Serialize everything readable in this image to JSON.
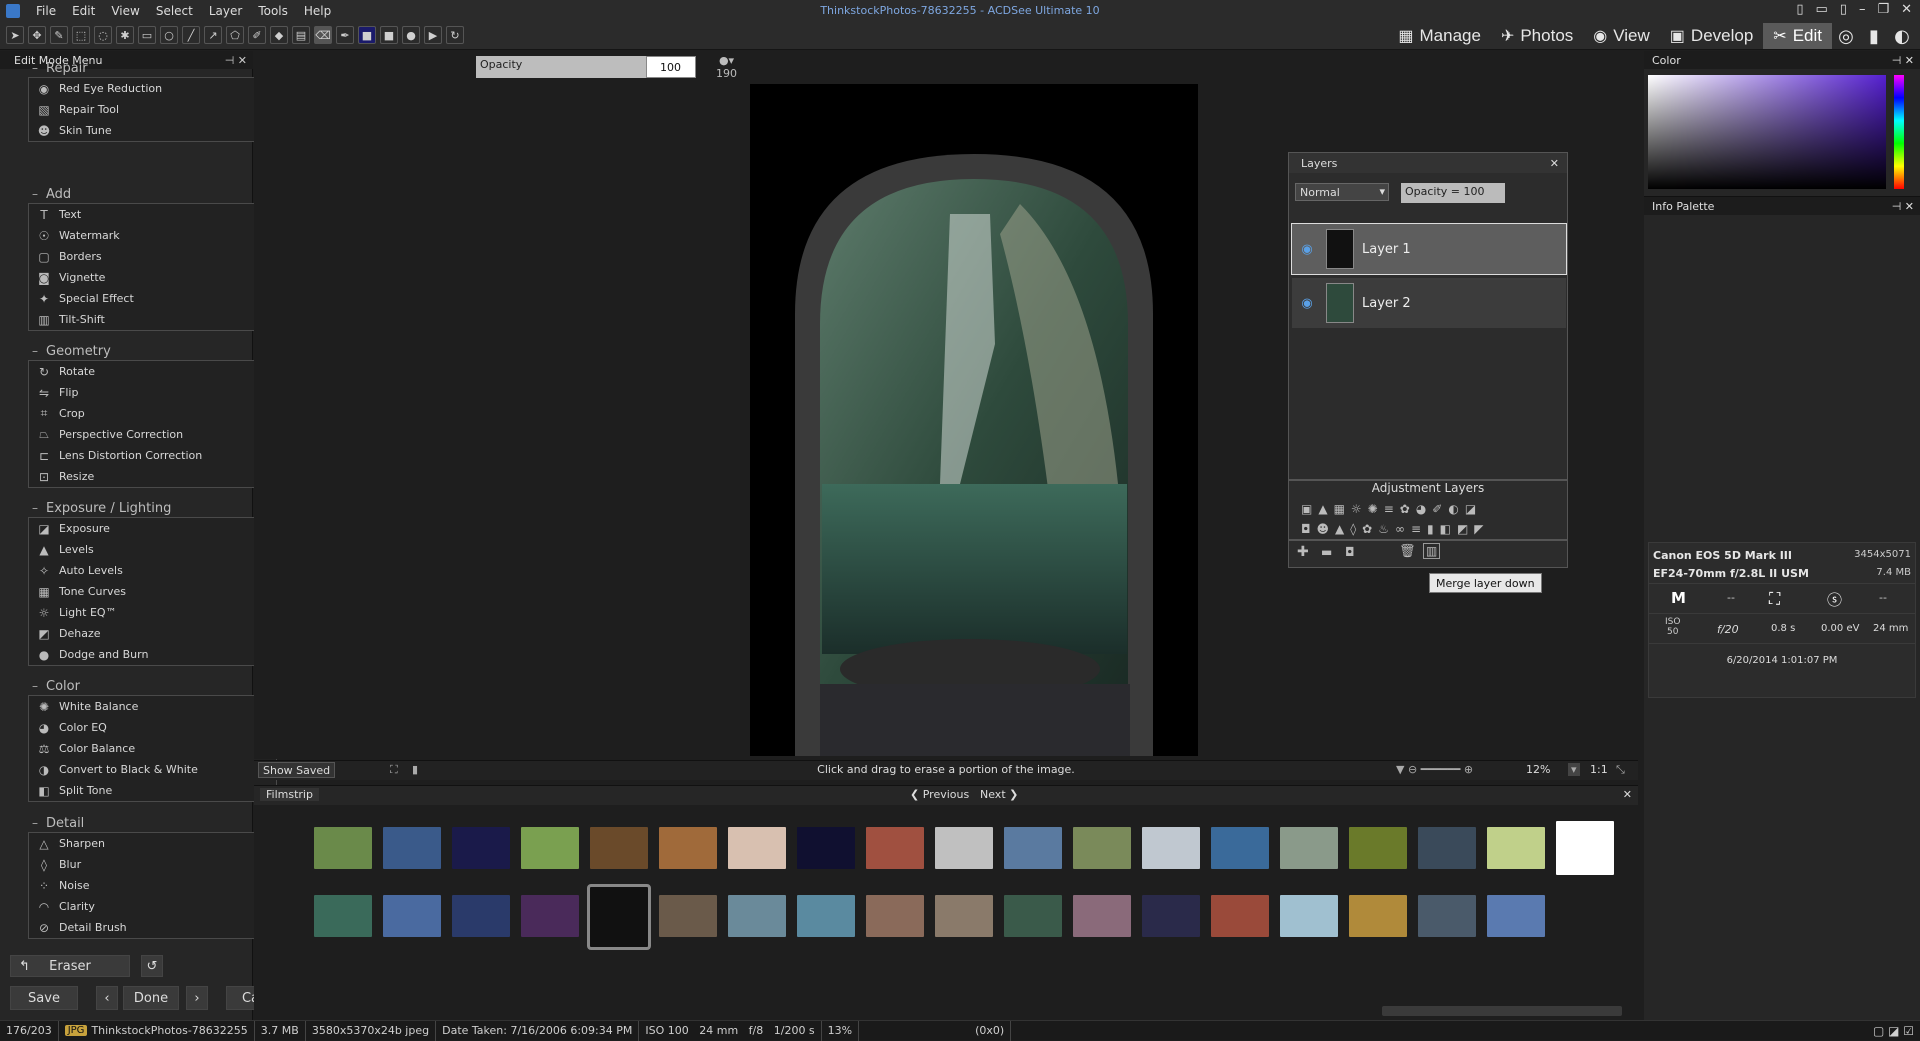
{
  "window": {
    "title": "ThinkstockPhotos-78632255 - ACDSee Ultimate 10"
  },
  "menu": [
    "File",
    "Edit",
    "View",
    "Select",
    "Layer",
    "Tools",
    "Help"
  ],
  "modes": [
    {
      "label": "Manage",
      "icon": "grid-icon"
    },
    {
      "label": "Photos",
      "icon": "photos-icon"
    },
    {
      "label": "View",
      "icon": "eye-icon"
    },
    {
      "label": "Develop",
      "icon": "develop-icon"
    },
    {
      "label": "Edit",
      "icon": "edit-icon",
      "active": true
    }
  ],
  "toolbar": {
    "opacity_label": "Opacity",
    "opacity_value": "100",
    "brush_size": "190"
  },
  "left_panel": {
    "title": "Edit Mode Menu",
    "sections": [
      {
        "name": "Repair",
        "items": [
          "Red Eye Reduction",
          "Repair Tool",
          "Skin Tune"
        ]
      },
      {
        "name": "Add",
        "items": [
          "Text",
          "Watermark",
          "Borders",
          "Vignette",
          "Special Effect",
          "Tilt-Shift"
        ]
      },
      {
        "name": "Geometry",
        "items": [
          "Rotate",
          "Flip",
          "Crop",
          "Perspective Correction",
          "Lens Distortion Correction",
          "Resize"
        ]
      },
      {
        "name": "Exposure / Lighting",
        "items": [
          "Exposure",
          "Levels",
          "Auto Levels",
          "Tone Curves",
          "Light EQ™",
          "Dehaze",
          "Dodge and Burn"
        ]
      },
      {
        "name": "Color",
        "items": [
          "White Balance",
          "Color EQ",
          "Color Balance",
          "Convert to Black & White",
          "Split Tone"
        ]
      },
      {
        "name": "Detail",
        "items": [
          "Sharpen",
          "Blur",
          "Noise",
          "Clarity",
          "Detail Brush"
        ]
      }
    ],
    "tool_name": "Eraser",
    "save_label": "Save",
    "done_label": "Done",
    "cancel_label": "Cancel"
  },
  "canvas": {
    "show_saved": "Show Saved",
    "hint": "Click and drag to erase a portion of the image.",
    "zoom": "12%",
    "ratio": "1:1"
  },
  "layers_palette": {
    "title": "Layers",
    "blend_mode": "Normal",
    "opacity": "Opacity = 100",
    "layers": [
      {
        "name": "Layer 1",
        "selected": true
      },
      {
        "name": "Layer 2",
        "selected": false
      }
    ],
    "adjustment_title": "Adjustment Layers",
    "tooltip": "Merge layer down"
  },
  "filmstrip": {
    "title": "Filmstrip",
    "previous": "Previous",
    "next": "Next"
  },
  "color_panel": {
    "title": "Color"
  },
  "info_palette": {
    "title": "Info Palette",
    "camera": "Canon EOS 5D Mark III",
    "dimensions": "3454x5071",
    "lens": "EF24-70mm f/2.8L II USM",
    "filesize": "7.4 MB",
    "mode": "M",
    "dash1": "--",
    "dash2": "--",
    "iso_label": "ISO",
    "iso": "50",
    "aperture": "f/20",
    "shutter": "0.8 s",
    "ev": "0.00 eV",
    "focal": "24 mm",
    "date": "6/20/2014 1:01:07 PM"
  },
  "statusbar": {
    "index": "176/203",
    "type": "JPG",
    "filename": "ThinkstockPhotos-78632255",
    "size": "3.7 MB",
    "dims": "3580x5370x24b jpeg",
    "date_taken": "Date Taken: 7/16/2006 6:09:34 PM",
    "exif": "ISO 100   24 mm   f/8   1/200 s",
    "zoom": "13%",
    "coords": "(0x0)"
  }
}
